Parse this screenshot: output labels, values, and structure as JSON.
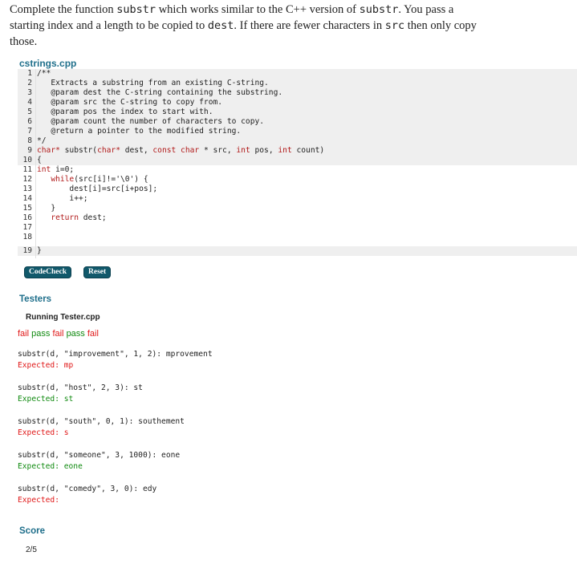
{
  "prompt": {
    "t1": "Complete the function ",
    "t2": "substr",
    "t3": " which works similar to the C++ version of ",
    "t4": "substr",
    "t5": ". You pass a starting index and a length to be copied to ",
    "t6": "dest",
    "t7": ". If there are fewer characters in ",
    "t8": "src",
    "t9": " then only copy those."
  },
  "file": {
    "name": "cstrings.cpp"
  },
  "code": {
    "l1": "/**",
    "l2": "   Extracts a substring from an existing C-string.",
    "l3": "   @param dest the C-string containing the substring.",
    "l4": "   @param src the C-string to copy from.",
    "l5": "   @param pos the index to start with.",
    "l6": "   @param count the number of characters to copy.",
    "l7": "   @return a pointer to the modified string.",
    "l8": "*/",
    "l9a": "char* ",
    "l9b": "substr(",
    "l9c": "char* ",
    "l9d": "dest, ",
    "l9e": "const char ",
    "l9f": "* src, ",
    "l9g": "int ",
    "l9h": "pos, ",
    "l9i": "int ",
    "l9j": "count)",
    "l10": "{",
    "l11a": "int ",
    "l11b": "i=0;",
    "l12a": "   while",
    "l12b": "(src[i]!='\\0') {",
    "l13": "       dest[i]=src[i+pos];",
    "l14": "       i++;",
    "l15": "   }",
    "l16a": "   return ",
    "l16b": "dest;",
    "l17": "",
    "l18": "",
    "l19": "}"
  },
  "buttons": {
    "codecheck": "CodeCheck",
    "reset": "Reset"
  },
  "testers": {
    "heading": "Testers",
    "running": "Running Tester.cpp",
    "summary": [
      "fail",
      "pass",
      "fail",
      "pass",
      "fail"
    ],
    "results": [
      {
        "call": "substr(d, \"improvement\", 1, 2): mprovement",
        "expected": "Expected: mp",
        "status": "fail"
      },
      {
        "call": "substr(d, \"host\", 2, 3): st",
        "expected": "Expected: st",
        "status": "pass"
      },
      {
        "call": "substr(d, \"south\", 0, 1): southement",
        "expected": "Expected: s",
        "status": "fail"
      },
      {
        "call": "substr(d, \"someone\", 3, 1000): eone",
        "expected": "Expected: eone",
        "status": "pass"
      },
      {
        "call": "substr(d, \"comedy\", 3, 0): edy",
        "expected": "Expected:",
        "status": "fail"
      }
    ]
  },
  "score": {
    "heading": "Score",
    "value": "2/5"
  },
  "colors": {
    "accent": "#1f6f8b",
    "fail": "#e01818",
    "pass": "#108a10",
    "button": "#11596b",
    "readonly_bg": "#efefef"
  }
}
